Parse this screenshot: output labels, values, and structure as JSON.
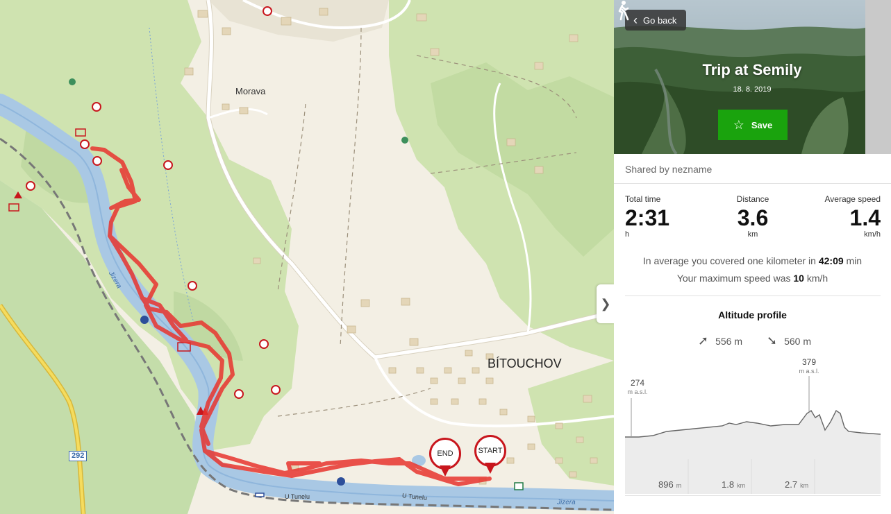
{
  "map": {
    "places": {
      "morava": "Morava",
      "bitouchov": "BÍTOUCHOV"
    },
    "streets": {
      "u_tunelu_1": "U Tunelu",
      "u_tunelu_2": "U Tunelu"
    },
    "rivers": {
      "jizera_1": "Jizera",
      "jizera_2": "Jizera"
    },
    "road_number": "292",
    "markers": {
      "end": "END",
      "start": "START"
    },
    "colors": {
      "route": "#e8352f",
      "marker": "#c8161d",
      "river": "#a9c8e4",
      "forest": "#cfe3b0"
    }
  },
  "panel": {
    "go_back": "Go back",
    "activity_icon": "hiking-icon",
    "title": "Trip at Semily",
    "date": "18. 8. 2019",
    "save": "Save",
    "shared_by": "Shared by nezname",
    "stats": {
      "time": {
        "label": "Total time",
        "value": "2:31",
        "unit": "h"
      },
      "distance": {
        "label": "Distance",
        "value": "3.6",
        "unit": "km"
      },
      "speed": {
        "label": "Average speed",
        "value": "1.4",
        "unit": "km/h"
      }
    },
    "pace": {
      "prefix": "In average you covered one kilometer in",
      "value": "42:09",
      "suffix": "min"
    },
    "max_speed": {
      "prefix": "Your maximum speed was",
      "value": "10",
      "suffix": "km/h"
    },
    "altitude": {
      "title": "Altitude profile",
      "ascent": "556 m",
      "descent": "560 m",
      "start_alt": "274",
      "max_alt": "379",
      "alt_unit": "m a.s.l.",
      "distances": [
        {
          "value": "896",
          "unit": "m"
        },
        {
          "value": "1.8",
          "unit": "km"
        },
        {
          "value": "2.7",
          "unit": "km"
        }
      ],
      "colors": {
        "line": "#666666",
        "fill": "#eeeeee"
      }
    }
  }
}
